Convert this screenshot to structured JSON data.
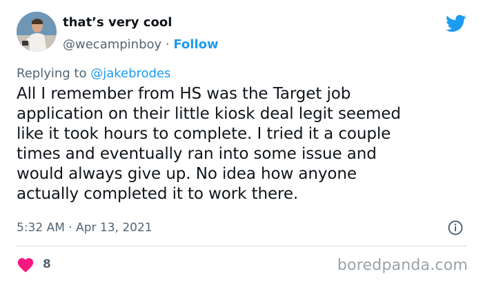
{
  "author": {
    "display_name": "that’s very cool",
    "handle": "@wecampinboy",
    "separator": " · ",
    "follow_label": "Follow"
  },
  "reply": {
    "prefix": "Replying to ",
    "handle": "@jakebrodes"
  },
  "tweet": {
    "lines": [
      "All I remember from HS was the Target job",
      "application on their little kiosk deal legit seemed",
      "like it took hours to complete. I tried it a couple",
      "times and eventually ran into some issue and",
      "would always give up. No idea how anyone",
      "actually completed it to work there."
    ]
  },
  "meta": {
    "timestamp": "5:32 AM · Apr 13, 2021"
  },
  "stats": {
    "likes": "8"
  },
  "watermark": "boredpanda.com",
  "colors": {
    "twitter_blue": "#1d9bf0",
    "like_pink": "#f91880",
    "secondary_text": "#536471",
    "divider": "#cfd9de"
  },
  "icons": [
    "avatar-photo",
    "twitter-bird-icon",
    "info-icon",
    "heart-icon"
  ]
}
